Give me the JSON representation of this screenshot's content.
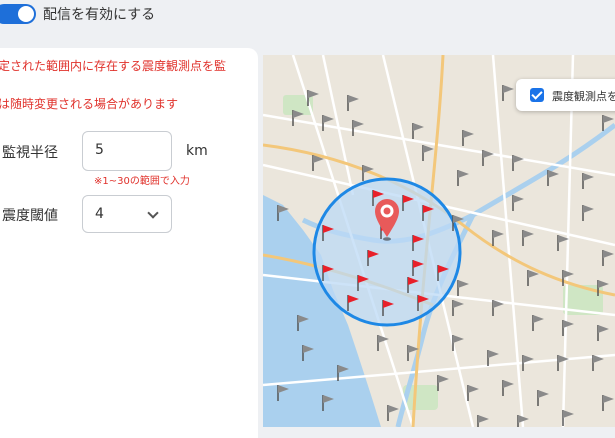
{
  "toggle": {
    "label": "配信を有効にする",
    "enabled": true
  },
  "notes": {
    "area_note": "定された範囲内に存在する震度観測点を監",
    "update_note": "は随時変更される場合があります"
  },
  "radius": {
    "label": "監視半径",
    "value": "5",
    "unit": "km",
    "hint": "※1~30の範囲で入力"
  },
  "threshold": {
    "label": "震度閾値",
    "value": "4"
  },
  "map": {
    "legend_label": "震度観測点を"
  },
  "colors": {
    "accent": "#1e6fd9",
    "error": "#e0312b",
    "circle_fill": "#bcd9f5",
    "circle_stroke": "#1e88e5",
    "flag_in": "#e8202a",
    "flag_out": "#8a8a8a"
  }
}
